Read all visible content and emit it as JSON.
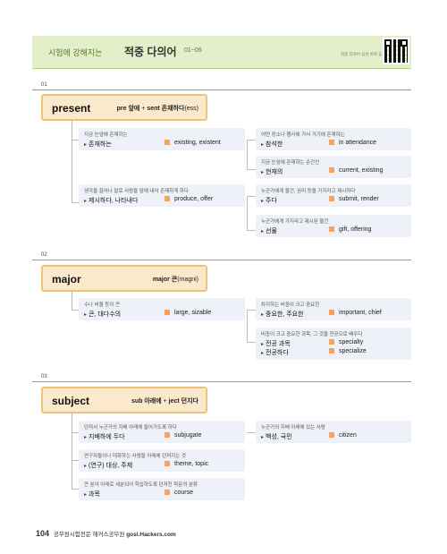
{
  "header": {
    "subtitle": "시험에 강해지는",
    "title": "적중 다의어",
    "range": "01~06",
    "qr_caption": "적중 다의어 음성 바로 듣기"
  },
  "sections": [
    {
      "num": "01",
      "term": "present",
      "ety_pre": "pre 앞에",
      "ety_plus": " + ",
      "ety_root": "sent 존재하다",
      "ety_paren": "(ess)",
      "cards": [
        {
          "desc": "지금 눈앞에 존재하는",
          "ko": "존재하는",
          "en": "existing, existent"
        },
        {
          "desc": "생각을 끌어나 말로 사람들 앞에 내어 존재하게 하다",
          "ko": "제시하다, 나타내다",
          "en": "produce, offer"
        },
        {
          "desc": "어떤 장소나 행사에 가서 거기에 존재하는",
          "ko": "참석한",
          "en": "in attendance"
        },
        {
          "desc": "지금 눈앞에 존재하는 순간인",
          "ko": "현재의",
          "en": "current, existing"
        },
        {
          "desc": "누군가에게 물건, 권리 등을 가지라고 제시하다",
          "ko": "주다",
          "en": "submit, render"
        },
        {
          "desc": "누군가에게 가지라고 제시된 물건",
          "ko": "선물",
          "en": "gift, offering"
        }
      ]
    },
    {
      "num": "02",
      "term": "major",
      "ety_pre": "",
      "ety_plus": "",
      "ety_root": "major 큰",
      "ety_paren": "(magni)",
      "cards": [
        {
          "desc": "수나 비율 등이 큰",
          "ko": "큰, 대다수의",
          "en": "large, sizable"
        },
        {
          "desc": "차지하는 비중이 크고 중요한",
          "ko": "중요한, 주요한",
          "en": "important, chief"
        },
        {
          "desc": "비중이 크고 중요한 과목, 그 것을 전공으로 배우다",
          "ko": "전공 과목",
          "ko2": "전공하다",
          "en": "specialty",
          "en2": "specialize"
        }
      ]
    },
    {
      "num": "03",
      "term": "subject",
      "ety_pre": "sub 아래에",
      "ety_plus": " + ",
      "ety_root": "ject 던지다",
      "ety_paren": "",
      "cards": [
        {
          "desc": "던져서 누군가의 지배 아래에 들어가도록 하다",
          "ko": "지배하에 두다",
          "en": "subjugate"
        },
        {
          "desc": "연구자들이나 대화하는 사람들 아래에 던져지는 것",
          "ko": "(연구) 대상, 주제",
          "en": "theme, topic"
        },
        {
          "desc": "큰 분야 아래로 세분되어 학습하도록 던져진 학문의 분류",
          "ko": "과목",
          "en": "course"
        },
        {
          "desc": "누군가의 지배 아래에 있는 사람",
          "ko": "백성, 국민",
          "en": "citizen"
        }
      ]
    }
  ],
  "footer": {
    "page": "104",
    "text": "공무원시험전문 해커스공무원",
    "site": "gosi.Hackers.com"
  }
}
